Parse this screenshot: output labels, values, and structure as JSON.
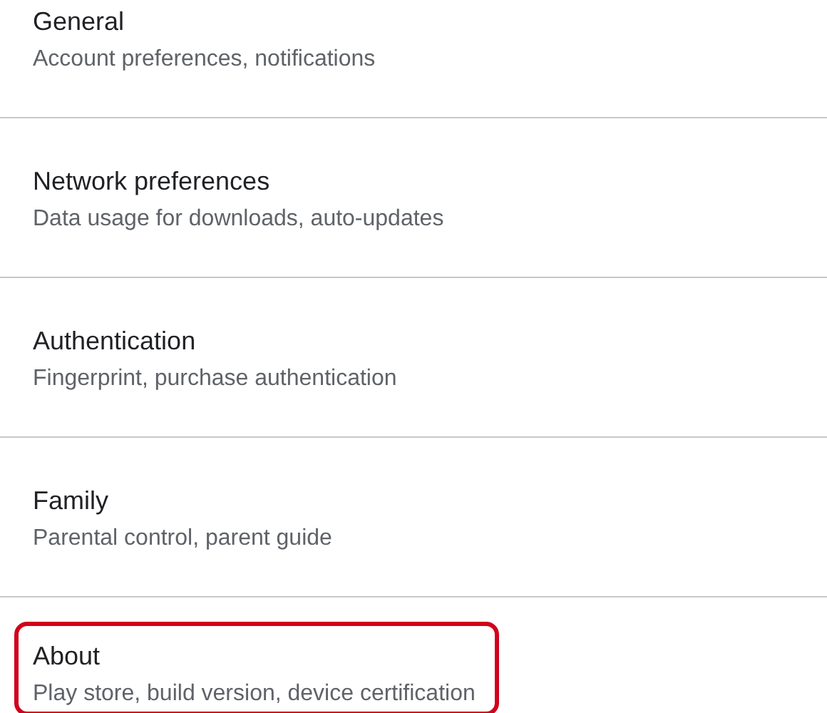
{
  "settings": [
    {
      "title": "General",
      "subtitle": "Account preferences, notifications",
      "highlighted": false
    },
    {
      "title": "Network preferences",
      "subtitle": "Data usage for downloads, auto-updates",
      "highlighted": false
    },
    {
      "title": "Authentication",
      "subtitle": "Fingerprint, purchase authentication",
      "highlighted": false
    },
    {
      "title": "Family",
      "subtitle": "Parental control, parent guide",
      "highlighted": false
    },
    {
      "title": "About",
      "subtitle": "Play store, build version, device certification",
      "highlighted": true
    }
  ]
}
